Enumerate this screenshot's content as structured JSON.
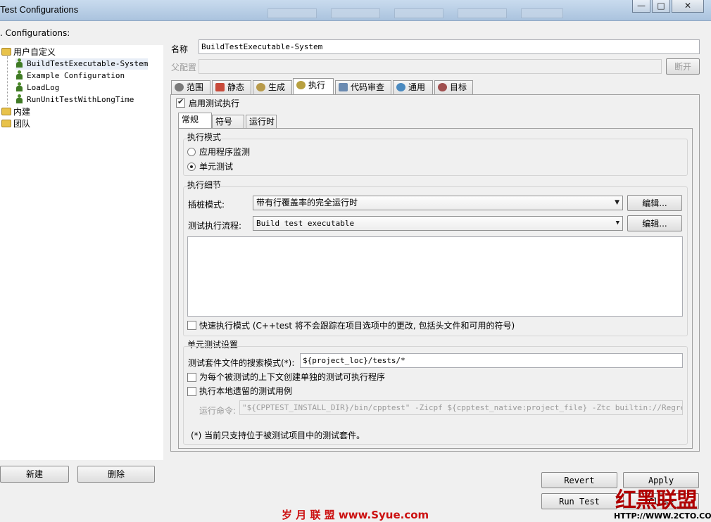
{
  "window": {
    "title": "Test Configurations",
    "min_glyph": "—",
    "max_glyph": "□",
    "close_glyph": "✕"
  },
  "left": {
    "header": ". Configurations:",
    "tree": [
      {
        "label": "用户自定义",
        "type": "folder"
      },
      {
        "label": "BuildTestExecutable-System",
        "type": "config"
      },
      {
        "label": "Example Configuration",
        "type": "config"
      },
      {
        "label": "LoadLog",
        "type": "config"
      },
      {
        "label": "RunUnitTestWithLongTime",
        "type": "config"
      },
      {
        "label": "内建",
        "type": "folder"
      },
      {
        "label": "团队",
        "type": "folder"
      }
    ],
    "new_button": "新建",
    "delete_button": "删除"
  },
  "form": {
    "name_label": "名称",
    "name_value": "BuildTestExecutable-System",
    "parent_label": "父配置",
    "parent_value": "",
    "disconnect_button": "断开"
  },
  "tabs": [
    {
      "label": "范围",
      "icon": "magnifier-icon"
    },
    {
      "label": "静态",
      "icon": "static-analysis-icon"
    },
    {
      "label": "生成",
      "icon": "generate-icon"
    },
    {
      "label": "执行",
      "icon": "execution-icon",
      "active": true
    },
    {
      "label": "代码审查",
      "icon": "code-review-icon"
    },
    {
      "label": "通用",
      "icon": "common-icon"
    },
    {
      "label": "目标",
      "icon": "target-icon"
    }
  ],
  "execution": {
    "enable_label": "启用测试执行",
    "enable_checked": true,
    "subtabs": [
      "常规",
      "符号",
      "运行时"
    ],
    "mode_group": "执行模式",
    "mode_app": "应用程序监测",
    "mode_unit": "单元测试",
    "mode_selected": "单元测试",
    "details_group": "执行细节",
    "instrument_label": "插桩模式:",
    "instrument_value": "带有行覆盖率的完全运行时",
    "edit_button": "编辑...",
    "flow_label": "测试执行流程:",
    "flow_value": "Build test executable",
    "flow_description": "",
    "fast_mode_label": "快速执行模式 (C++test 将不会跟踪在项目选项中的更改, 包括头文件和可用的符号)",
    "fast_mode_checked": false,
    "unit_group": "单元测试设置",
    "search_label": "测试套件文件的搜索模式(*):",
    "search_value": "${project_loc}/tests/*",
    "separate_label": "为每个被测试的上下文创建单独的测试可执行程序",
    "separate_checked": false,
    "legacy_label": "执行本地遗留的测试用例",
    "legacy_checked": false,
    "run_cmd_label": "运行命令:",
    "run_cmd_value": "\"${CPPTEST_INSTALL_DIR}/bin/cpptest\" -Zicpf ${cpptest_native:project_file} -Ztc builtin://RegressionTest",
    "footnote": "(*) 当前只支持位于被测试项目中的测试套件。"
  },
  "bottom": {
    "revert": "Revert",
    "apply": "Apply",
    "run_test": "Run Test",
    "close": "Close"
  },
  "watermarks": {
    "center": "岁 月 联 盟  www.Syue.com",
    "brand": "红黑联盟",
    "url": "HTTP://WWW.2CTO.COM"
  }
}
